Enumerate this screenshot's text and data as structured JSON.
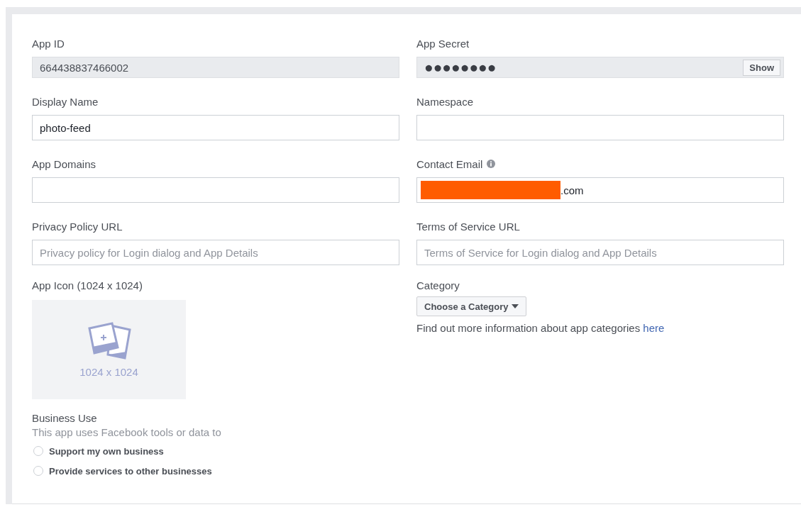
{
  "fields": [
    {
      "label": "App ID",
      "kind": "readonly",
      "value": "664438837466002"
    },
    {
      "label": "App Secret",
      "kind": "secret",
      "value": "●●●●●●●●",
      "button": "Show"
    },
    {
      "label": "Display Name",
      "kind": "text",
      "value": "photo-feed"
    },
    {
      "label": "Namespace",
      "kind": "text"
    },
    {
      "label": "App Domains",
      "kind": "text"
    },
    {
      "label": "Contact Email",
      "kind": "text",
      "info": true,
      "value": ".com",
      "redacted": true
    },
    {
      "label": "Privacy Policy URL",
      "kind": "text",
      "placeholder": "Privacy policy for Login dialog and App Details"
    },
    {
      "label": "Terms of Service URL",
      "kind": "text",
      "placeholder": "Terms of Service for Login dialog and App Details"
    }
  ],
  "app_icon": {
    "label": "App Icon (1024 x 1024)",
    "caption": "1024 x 1024"
  },
  "business_use": {
    "label": "Business Use",
    "hint": "This app uses Facebook tools or data to",
    "options": [
      {
        "label": "Support my own business",
        "selected": false
      },
      {
        "label": "Provide services to other businesses",
        "selected": false
      }
    ]
  },
  "category": {
    "label": "Category",
    "dropdown": "Choose a Category",
    "help": "Find out more information about app categories",
    "link": "here"
  }
}
